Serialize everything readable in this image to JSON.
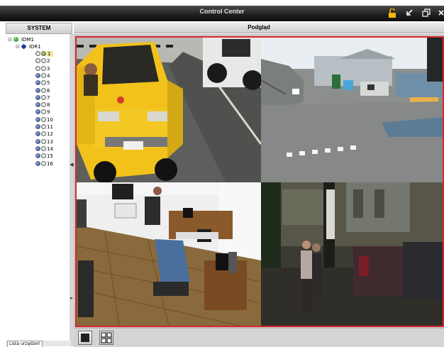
{
  "window": {
    "title": "Control Center"
  },
  "left_panel": {
    "header": "SYSTEM",
    "tab_label": "Lista urządzeń"
  },
  "right_panel": {
    "header": "Podgląd"
  },
  "tree": {
    "root": "IDM1",
    "recorder": "IDR1",
    "channels": [
      "1",
      "2",
      "3",
      "4",
      "5",
      "6",
      "7",
      "8",
      "9",
      "10",
      "11",
      "12",
      "13",
      "14",
      "15",
      "16"
    ],
    "selected": "1"
  },
  "layout_buttons": [
    "single-view",
    "quad-view"
  ],
  "colors": {
    "grid_border": "#d8282e",
    "titlebar": "#1e1e1e",
    "selection": "#f7e49c"
  }
}
